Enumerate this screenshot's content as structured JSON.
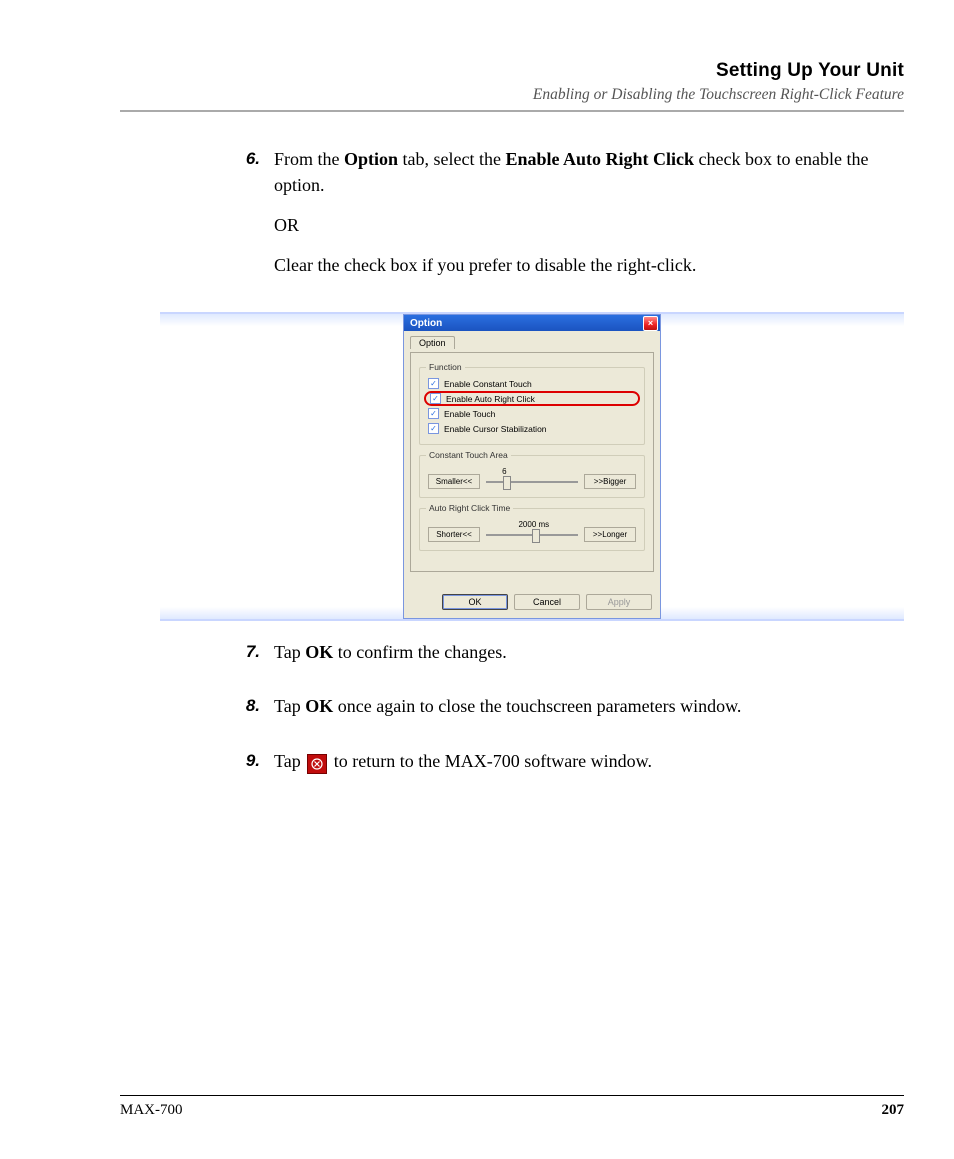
{
  "header": {
    "title": "Setting Up Your Unit",
    "subtitle": "Enabling or Disabling the Touchscreen Right-Click Feature"
  },
  "steps": {
    "s6": {
      "num": "6.",
      "p1_a": "From the ",
      "p1_b": "Option",
      "p1_c": " tab, select the ",
      "p1_d": "Enable Auto Right Click",
      "p1_e": " check box to enable the option.",
      "p2": "OR",
      "p3": "Clear the check box if you prefer to disable the right-click."
    },
    "s7": {
      "num": "7.",
      "a": "Tap ",
      "b": "OK",
      "c": " to confirm the changes."
    },
    "s8": {
      "num": "8.",
      "a": "Tap ",
      "b": "OK",
      "c": " once again to close the touchscreen parameters window."
    },
    "s9": {
      "num": "9.",
      "a": "Tap ",
      "c": " to return to the MAX-700 software window."
    }
  },
  "dialog": {
    "title": "Option",
    "tab": "Option",
    "group_function": "Function",
    "chk_constant_touch": "Enable Constant Touch",
    "chk_auto_right_click": "Enable Auto Right Click",
    "chk_touch": "Enable Touch",
    "chk_cursor_stab": "Enable Cursor Stabilization",
    "group_touch_area": "Constant Touch Area",
    "touch_area_value": "6",
    "btn_smaller": "Smaller<<",
    "btn_bigger": ">>Bigger",
    "group_rc_time": "Auto Right Click Time",
    "rc_time_value": "2000 ms",
    "btn_shorter": "Shorter<<",
    "btn_longer": ">>Longer",
    "btn_ok": "OK",
    "btn_cancel": "Cancel",
    "btn_apply": "Apply"
  },
  "footer": {
    "product": "MAX-700",
    "page": "207"
  }
}
